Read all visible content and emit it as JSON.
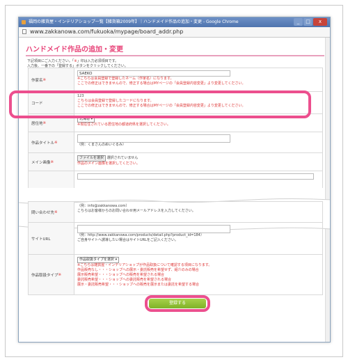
{
  "window": {
    "title": "福岡の雑貨屋・インテリアショップ一覧【雑貨箱2009年】｜ハンドメイド作品の追加・変更 - Google Chrome",
    "url": "www.zakkanowa.com/fukuoka/mypage/board_addr.php",
    "minimize": "_",
    "maximize": "□",
    "close": "x"
  },
  "page": {
    "heading": "ハンドメイド作品の追加・変更",
    "intro_line1_a": "下記項目にご入力ください。「",
    "intro_line1_req": "※",
    "intro_line1_b": "」印は入力必須項目です。",
    "intro_line2": "入力後、一番下の「登録する」ボタンをクリックしてください。"
  },
  "form_top": [
    {
      "label": "作家名",
      "req": "※",
      "value": "SAEKO",
      "notes": [
        "※こちらは会員登録で登録したネーム（作家名）になります。",
        "ここでの修正はできませんので、修正する場合はMYページの「会員登録内容変更」より変更してください。"
      ]
    },
    {
      "label": "コード",
      "req": "",
      "value": "123",
      "notes": [
        "こちらは会員登録で登録したコードになります。",
        "ここでの修正はできませんので、修正する場合はMYページの「会員登録内容変更」より変更してください。"
      ]
    },
    {
      "label": "居住地",
      "req": "※",
      "select": "北海道",
      "notes": [
        "※現在住されている居住地の都道府県を選択してください。"
      ]
    },
    {
      "label": "作品タイトル",
      "req": "※",
      "value": "",
      "hint": "（例：くまさんのぬいぐるみ）"
    },
    {
      "label": "メイン画像",
      "req": "※",
      "file_button": "ファイルを選択",
      "file_status": "選択されていません",
      "notes": [
        "作品のメイン画像を選択してください。"
      ]
    }
  ],
  "form_bottom": [
    {
      "label": "問い合わせ先",
      "req": "※",
      "hint": "（例：info@zakkanowa.com）",
      "note": "こちらはお客様からのお問い合わせ用メールアドレスを入力してください。"
    },
    {
      "label": "サイトURL",
      "req": "",
      "hint": "（例：http://www.zakkanowa.com/products/detail.php?product_id=184）",
      "note": "ご自身サイトへ誘導したい場合はサイトURLをご記入ください。"
    },
    {
      "label": "作品取扱タイプ",
      "req": "※",
      "select": "作品取扱タイプを選択",
      "notes": [
        "※こちらは雑貨屋・インテリアショップが作品取扱について確認する項目になります。",
        "作品販売なし・・・ショップへの展示・委託販売を希望せず、紹介のみの場合",
        "展示販売希望・・・ショップへの販売を希望される場合",
        "委託販売希望・・・ショップへの委託販売を希望される場合",
        "展示・委託販売希望・・・ショップへの販売を展示または委託を希望する場合"
      ]
    }
  ],
  "submit": {
    "label": "登録する"
  }
}
